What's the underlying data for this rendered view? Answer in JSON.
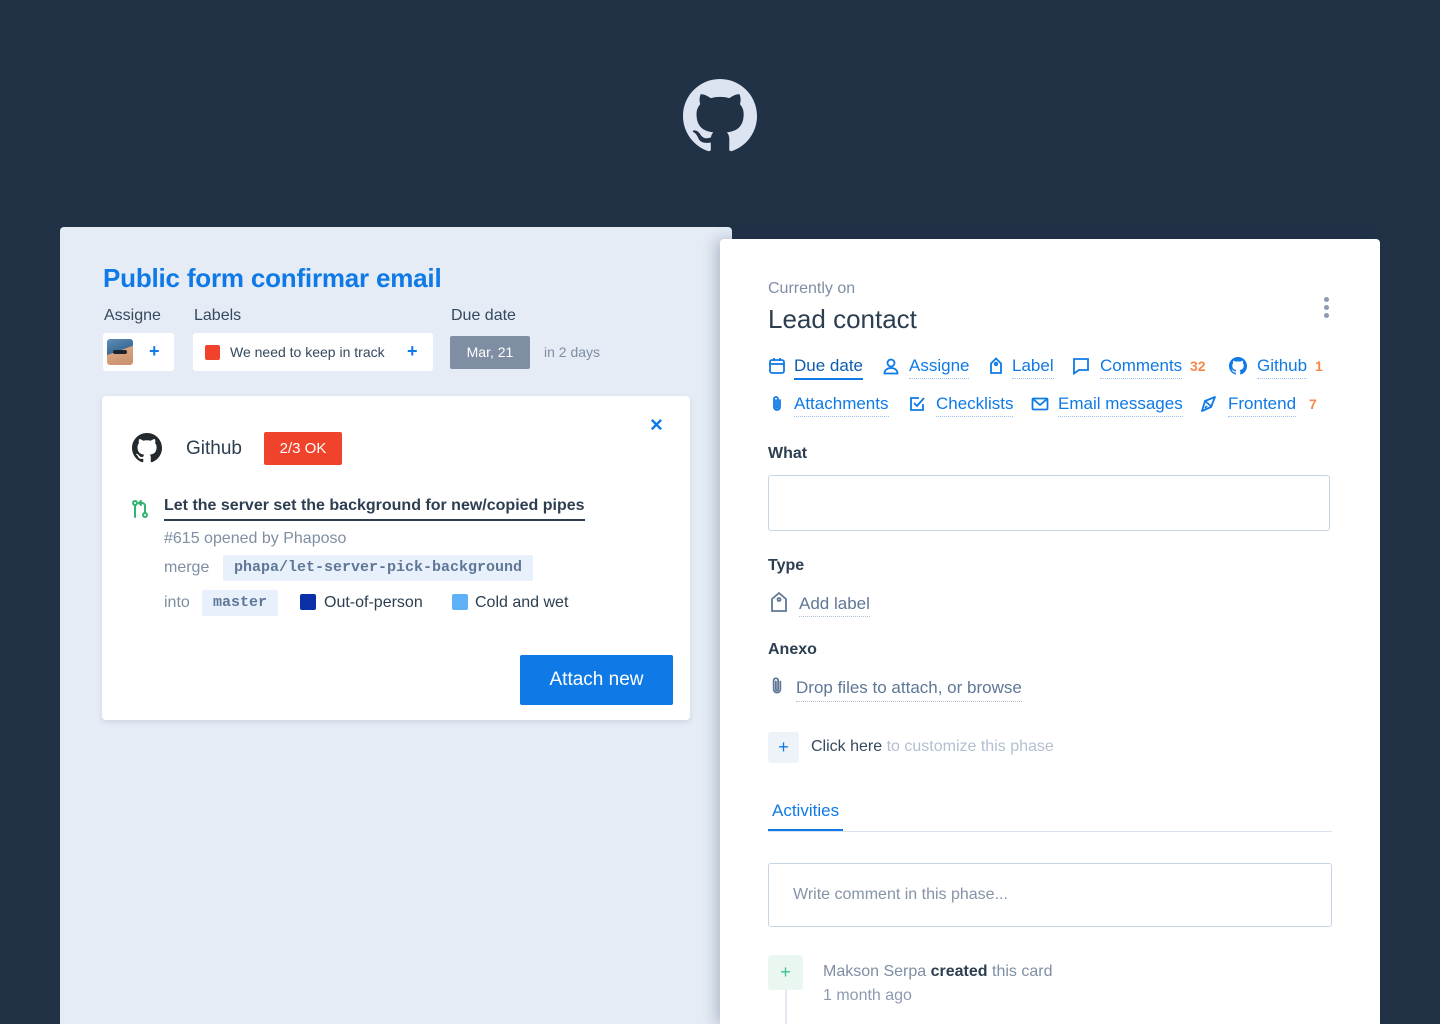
{
  "card": {
    "title": "Public form confirmar email",
    "assignee_label": "Assigne",
    "labels_label": "Labels",
    "due_label": "Due date",
    "label_text": "We need to keep in track",
    "label_color": "#f0432c",
    "due_value": "Mar, 21",
    "due_relative": "in 2 days",
    "plus": "+"
  },
  "github_card": {
    "title": "Github",
    "status_badge": "2/3 OK",
    "close": "×",
    "pr_title": "Let the server set the background for new/copied pipes",
    "pr_meta": "#615 opened by Phaposo",
    "merge_label": "merge",
    "merge_branch": "phapa/let-server-pick-background",
    "into_label": "into",
    "into_branch": "master",
    "tags": [
      {
        "name": "Out-of-person",
        "color": "#0a2fa6"
      },
      {
        "name": "Cold and wet",
        "color": "#5fb1f7"
      }
    ],
    "attach_button": "Attach new"
  },
  "phase": {
    "currently_on": "Currently on",
    "name": "Lead contact",
    "actions": [
      {
        "label": "Due date",
        "icon": "calendar-icon",
        "count": ""
      },
      {
        "label": "Assigne",
        "icon": "user-icon",
        "count": ""
      },
      {
        "label": "Label",
        "icon": "tag-icon",
        "count": ""
      },
      {
        "label": "Comments",
        "icon": "comment-icon",
        "count": "32"
      },
      {
        "label": "Github",
        "icon": "github-icon",
        "count": "1"
      },
      {
        "label": "Attachments",
        "icon": "paperclip-icon",
        "count": ""
      },
      {
        "label": "Checklists",
        "icon": "checklist-icon",
        "count": ""
      },
      {
        "label": "Email messages",
        "icon": "mail-icon",
        "count": ""
      },
      {
        "label": "Frontend",
        "icon": "rocket-icon",
        "count": "7"
      }
    ],
    "what_label": "What",
    "type_label": "Type",
    "add_label": "Add label",
    "anexo_label": "Anexo",
    "drop_files": "Drop files to attach, or browse",
    "customize_plus": "+",
    "customize_strong": "Click here",
    "customize_rest": " to customize this phase",
    "activities_tab": "Activities",
    "comment_placeholder": "Write comment in this phase...",
    "activity": {
      "plus": "+",
      "user": "Makson Serpa",
      "verb": "created",
      "object": " this card",
      "time": "1 month ago"
    }
  }
}
